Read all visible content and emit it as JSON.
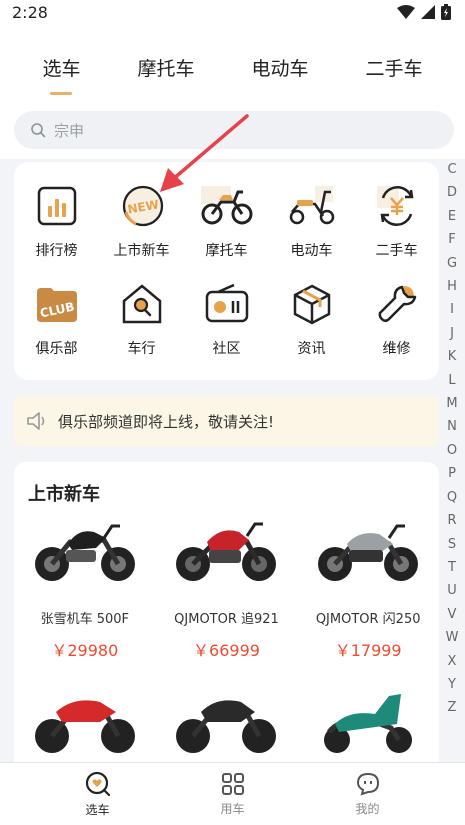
{
  "status": {
    "time": "2:28"
  },
  "tabs": [
    {
      "label": "选车",
      "active": true
    },
    {
      "label": "摩托车",
      "active": false
    },
    {
      "label": "电动车",
      "active": false
    },
    {
      "label": "二手车",
      "active": false
    }
  ],
  "search": {
    "placeholder": "宗申"
  },
  "categories": [
    {
      "label": "排行榜",
      "icon": "ranking-chart-icon"
    },
    {
      "label": "上市新车",
      "icon": "new-badge-icon",
      "badge": "NEW"
    },
    {
      "label": "摩托车",
      "icon": "motorcycle-icon"
    },
    {
      "label": "电动车",
      "icon": "scooter-icon"
    },
    {
      "label": "二手车",
      "icon": "yen-cycle-icon"
    },
    {
      "label": "俱乐部",
      "icon": "club-icon",
      "badge": "CLUB"
    },
    {
      "label": "车行",
      "icon": "store-icon"
    },
    {
      "label": "社区",
      "icon": "radio-icon"
    },
    {
      "label": "资讯",
      "icon": "cube-icon"
    },
    {
      "label": "维修",
      "icon": "wrench-icon"
    }
  ],
  "notice": {
    "text": "俱乐部频道即将上线，敬请关注!"
  },
  "new_cars": {
    "title": "上市新车",
    "items": [
      {
        "name": "张雪机车 500F",
        "price": "￥29980",
        "color": "#1f1f1f"
      },
      {
        "name": "QJMOTOR 追921",
        "price": "￥66999",
        "color": "#c8232b"
      },
      {
        "name": "QJMOTOR 闪250",
        "price": "￥17999",
        "color": "#9aa0a4"
      }
    ],
    "more": [
      {
        "color": "#d42a2a"
      },
      {
        "color": "#2a2a2a"
      },
      {
        "color": "#1e8a7a"
      }
    ]
  },
  "alphabet": [
    "C",
    "D",
    "E",
    "F",
    "G",
    "H",
    "I",
    "J",
    "K",
    "L",
    "M",
    "N",
    "O",
    "P",
    "Q",
    "R",
    "S",
    "T",
    "U",
    "V",
    "W",
    "X",
    "Y",
    "Z"
  ],
  "bottom_nav": [
    {
      "label": "选车",
      "active": true
    },
    {
      "label": "用车",
      "active": false
    },
    {
      "label": "我的",
      "active": false
    }
  ]
}
